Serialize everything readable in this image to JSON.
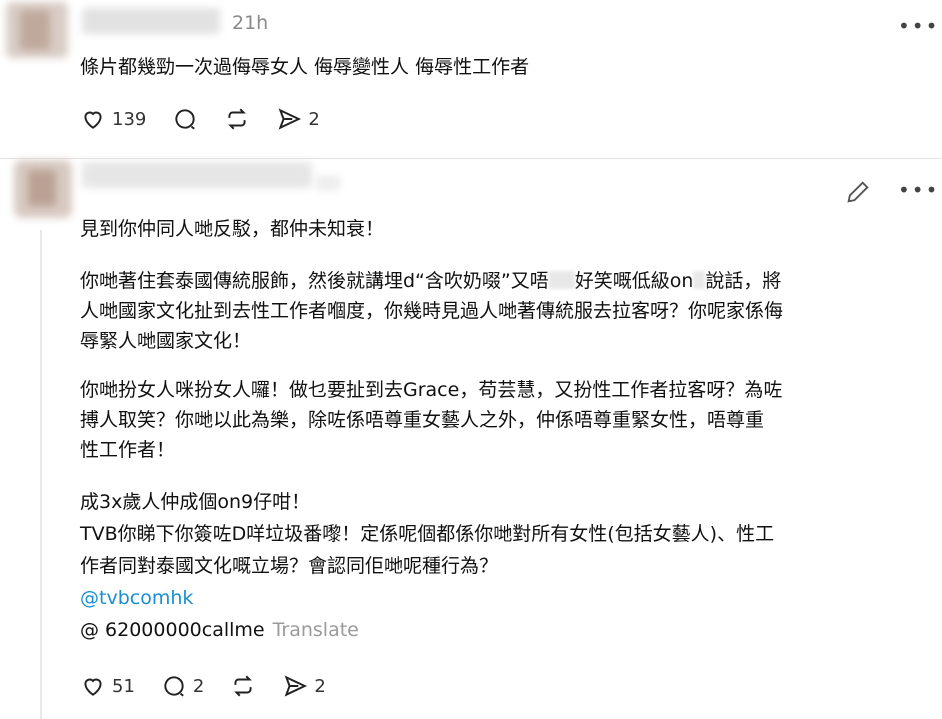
{
  "post1": {
    "time": "21h",
    "text": "條片都幾勁一次過侮辱女人 侮辱變性人 侮辱性工作者",
    "likes": "139",
    "shares": "2"
  },
  "post2": {
    "paragraph1": "見到你仲同人哋反駁，都仲未知衰！",
    "p2_line1a": "你哋著住套泰國傳統服飾，然後就講埋d“含吹奶啜”又唔",
    "p2_line1b": "好笑嘅低級on",
    "p2_line1c": "說話，將",
    "p2_line2": "人哋國家文化扯到去性工作者嗰度，你幾時見過人哋著傳統服去拉客呀？你呢家係侮",
    "p2_line3": "辱緊人哋國家文化！",
    "p3_line1": "你哋扮女人咪扮女人囉！做乜要扯到去Grace，苟芸慧，又扮性工作者拉客呀？為咗",
    "p3_line2": "搏人取笑？你哋以此為樂，除咗係唔尊重女藝人之外，仲係唔尊重緊女性，唔尊重",
    "p3_line3": "性工作者！",
    "p4_line1": "成3x歲人仲成個on9仔咁！",
    "p4_line2": "TVB你睇下你簽咗D咩垃圾番嚟！定係呢個都係你哋對所有女性(包括女藝人)、性工",
    "p4_line3": "作者同對泰國文化嘅立場？會認同佢哋呢種行為？",
    "mention": "@tvbcomhk",
    "handle": "@ 62000000callme",
    "translate": "Translate",
    "likes": "51",
    "replies": "2",
    "shares": "2"
  },
  "icons": [
    "heart-icon",
    "comment-icon",
    "repost-icon",
    "share-icon",
    "more-icon",
    "edit-icon"
  ],
  "colors": {
    "link": "#1a8fd0",
    "muted": "#9a9a9a"
  }
}
